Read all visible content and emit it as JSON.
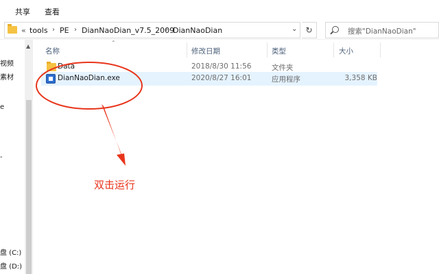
{
  "ribbon": {
    "tabs": [
      "共享",
      "查看"
    ]
  },
  "address": {
    "overflow": "«",
    "breadcrumbs": [
      "tools",
      "PE",
      "DianNaoDian_v7.5_2009",
      "DianNaoDian"
    ],
    "separator": "›"
  },
  "search": {
    "placeholder": "搜索\"DianNaoDian\""
  },
  "nav": {
    "items": [
      "视频",
      "素材",
      "e",
      "-",
      "盘 (C:)",
      "盘 (D:)"
    ]
  },
  "columns": {
    "name": "名称",
    "date": "修改日期",
    "type": "类型",
    "size": "大小"
  },
  "files": [
    {
      "name": "Data",
      "date": "2018/8/30 11:56",
      "type": "文件夹",
      "size": "",
      "icon": "folder-icon"
    },
    {
      "name": "DianNaoDian.exe",
      "date": "2020/8/27 16:01",
      "type": "应用程序",
      "size": "3,358 KB",
      "icon": "exe-icon"
    }
  ],
  "annotation": {
    "text": "双击运行",
    "color": "#e8341b"
  }
}
